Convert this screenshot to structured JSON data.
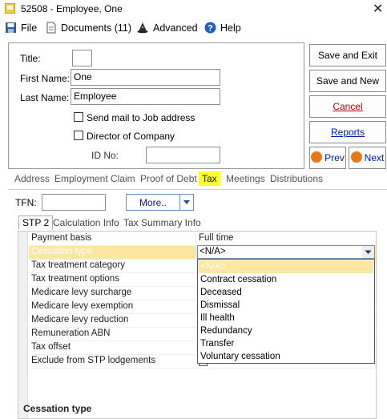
{
  "window": {
    "title": "52508 - Employee, One",
    "close_glyph": "✕"
  },
  "menu": {
    "file": "File",
    "documents": "Documents (11)",
    "advanced": "Advanced",
    "help": "Help"
  },
  "form": {
    "title_label": "Title:",
    "title_value": "",
    "first_name_label": "First Name:",
    "first_name_value": "One",
    "last_name_label": "Last Name:",
    "last_name_value": "Employee",
    "send_mail_label": "Send mail to Job address",
    "send_mail_checked": false,
    "director_label": "Director of Company",
    "director_checked": false,
    "id_no_label": "ID No:",
    "id_no_value": ""
  },
  "buttons": {
    "save_exit": "Save and Exit",
    "save_new": "Save and New",
    "cancel": "Cancel",
    "reports": "Reports",
    "prev": "Prev",
    "next": "Next"
  },
  "tabs": [
    "Address",
    "Employment",
    "Claim",
    "Proof of Debt",
    "Tax",
    "Meetings",
    "Distributions"
  ],
  "active_tab": "Tax",
  "tax": {
    "tfn_label": "TFN:",
    "tfn_value": "",
    "more_button": "More..",
    "subtabs": [
      "STP 2",
      "Calculation Info",
      "Tax Summary Info"
    ],
    "active_subtab": "STP 2"
  },
  "grid": {
    "rows": [
      {
        "name": "Payment basis",
        "value": "Full time"
      },
      {
        "name": "Cessation type",
        "value": "<N/A>"
      },
      {
        "name": "Tax treatment category",
        "value": ""
      },
      {
        "name": "Tax treatment options",
        "value": ""
      },
      {
        "name": "Medicare levy surcharge",
        "value": ""
      },
      {
        "name": "Medicare levy exemption",
        "value": ""
      },
      {
        "name": "Medicare levy reduction",
        "value": ""
      },
      {
        "name": "Remuneration ABN",
        "value": ""
      },
      {
        "name": "Tax offset",
        "value": ""
      },
      {
        "name": "Exclude from STP lodgements",
        "value": ""
      }
    ],
    "selected_row": "Cessation type",
    "description_caption": "Cessation type"
  },
  "dropdown": {
    "options": [
      "<N/A>",
      "Contract cessation",
      "Deceased",
      "Dismissal",
      "Ill health",
      "Redundancy",
      "Transfer",
      "Voluntary cessation"
    ],
    "highlighted": "<N/A>"
  },
  "colors": {
    "tab_highlight": "#ffff2d",
    "selection": "#fbe6a2",
    "cancel_text": "#c00000",
    "link_text": "#0018b0",
    "nav_icon": "#e77817"
  }
}
